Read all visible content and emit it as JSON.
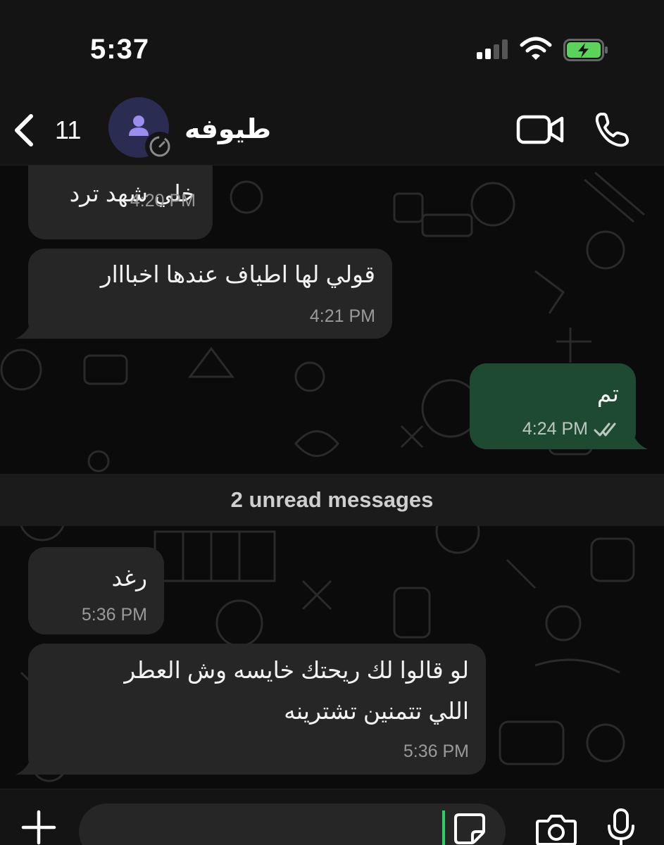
{
  "status_bar": {
    "time": "5:37",
    "signal_icon": "cellular-signal-icon",
    "wifi_icon": "wifi-icon",
    "battery_icon": "battery-charging-icon",
    "battery_color": "#5bd35b"
  },
  "header": {
    "back_icon": "chevron-left-icon",
    "back_count": "11",
    "avatar_icon": "person-icon",
    "contact_name": "طيوفه",
    "video_icon": "video-camera-icon",
    "call_icon": "phone-icon"
  },
  "messages": [
    {
      "direction": "incoming",
      "text": "خلي شهد ترد",
      "time": "4:20 PM"
    },
    {
      "direction": "incoming",
      "text": "قولي لها اطياف عندها اخبااار",
      "time": "4:21 PM"
    },
    {
      "direction": "outgoing",
      "text": "تم",
      "time": "4:24 PM",
      "status_icon": "double-check-icon"
    },
    {
      "direction": "incoming",
      "text": "رغد",
      "time": "5:36 PM"
    },
    {
      "direction": "incoming",
      "lines": [
        "لو قالوا لك ريحتك خايسه وش العطر",
        "اللي تتمنين تشترينه"
      ],
      "time": "5:36 PM"
    }
  ],
  "unread_divider": "2 unread messages",
  "composer": {
    "plus_icon": "plus-icon",
    "input_value": "",
    "sticker_icon": "sticker-icon",
    "camera_icon": "camera-icon",
    "mic_icon": "microphone-icon"
  },
  "colors": {
    "incoming_bubble": "#262626",
    "outgoing_bubble": "#1e4a31",
    "background": "#0b0b0b",
    "accent": "#25d366"
  }
}
